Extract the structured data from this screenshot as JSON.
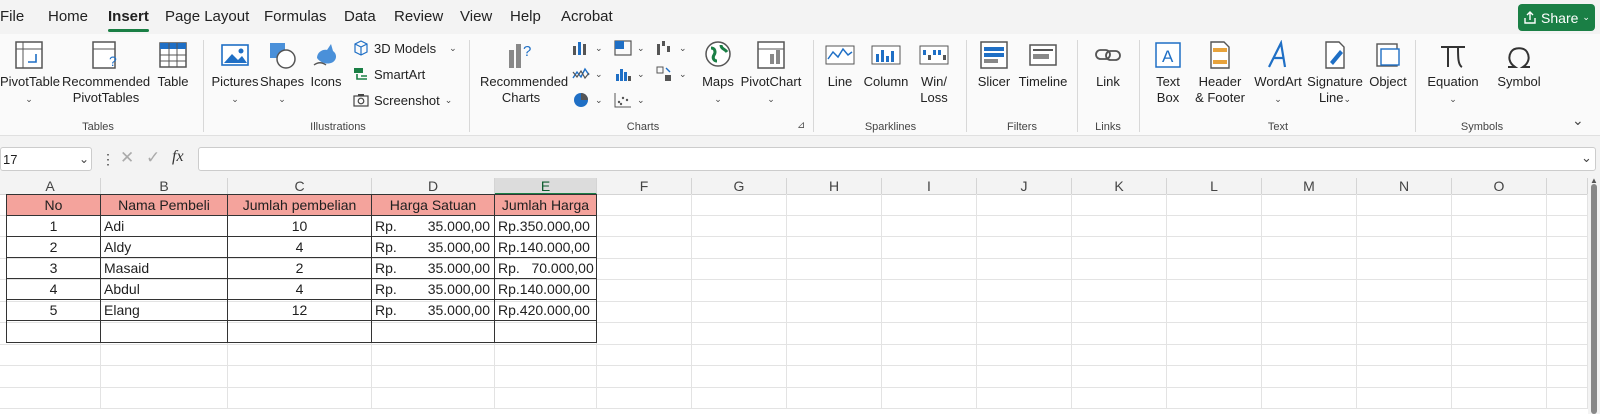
{
  "tabs": {
    "file": "File",
    "home": "Home",
    "insert": "Insert",
    "page_layout": "Page Layout",
    "formulas": "Formulas",
    "data": "Data",
    "review": "Review",
    "view": "View",
    "help": "Help",
    "acrobat": "Acrobat"
  },
  "share": {
    "label": "Share"
  },
  "ribbon": {
    "tables": {
      "pivottable": "PivotTable",
      "recommended_pivottables": [
        "Recommended",
        "PivotTables"
      ],
      "table": "Table",
      "group": "Tables"
    },
    "illustrations": {
      "pictures": "Pictures",
      "shapes": "Shapes",
      "icons": "Icons",
      "models_3d": "3D Models",
      "smartart": "SmartArt",
      "screenshot": "Screenshot",
      "group": "Illustrations"
    },
    "charts": {
      "recommended_charts": [
        "Recommended",
        "Charts"
      ],
      "maps": "Maps",
      "pivotchart": "PivotChart",
      "group": "Charts"
    },
    "sparklines": {
      "line": "Line",
      "column": "Column",
      "winloss": [
        "Win/",
        "Loss"
      ],
      "group": "Sparklines"
    },
    "filters": {
      "slicer": "Slicer",
      "timeline": "Timeline",
      "group": "Filters"
    },
    "links": {
      "link": "Link",
      "group": "Links"
    },
    "text": {
      "textbox": [
        "Text",
        "Box"
      ],
      "header_footer": [
        "Header",
        "& Footer"
      ],
      "wordart": "WordArt",
      "signature_line": [
        "Signature",
        "Line"
      ],
      "object": "Object",
      "group": "Text"
    },
    "symbols": {
      "equation": "Equation",
      "symbol": "Symbol",
      "group": "Symbols"
    }
  },
  "formula_bar": {
    "name_box": "17",
    "fx": "fx",
    "formula": ""
  },
  "columns": [
    "A",
    "B",
    "C",
    "D",
    "E",
    "F",
    "G",
    "H",
    "I",
    "J",
    "K",
    "L",
    "M",
    "N",
    "O"
  ],
  "table": {
    "headers": [
      "No",
      "Nama Pembeli",
      "Jumlah pembelian",
      "Harga Satuan",
      "Jumlah Harga"
    ],
    "rows": [
      {
        "no": "1",
        "nama": "Adi",
        "jumlah": "10",
        "rp": "Rp.",
        "harga": "35.000,00",
        "total": "Rp.350.000,00"
      },
      {
        "no": "2",
        "nama": "Aldy",
        "jumlah": "4",
        "rp": "Rp.",
        "harga": "35.000,00",
        "total": "Rp.140.000,00"
      },
      {
        "no": "3",
        "nama": "Masaid",
        "jumlah": "2",
        "rp": "Rp.",
        "harga": "35.000,00",
        "total": "Rp.   70.000,00"
      },
      {
        "no": "4",
        "nama": "Abdul",
        "jumlah": "4",
        "rp": "Rp.",
        "harga": "35.000,00",
        "total": "Rp.140.000,00"
      },
      {
        "no": "5",
        "nama": "Elang",
        "jumlah": "12",
        "rp": "Rp.",
        "harga": "35.000,00",
        "total": "Rp.420.000,00"
      }
    ]
  },
  "colors": {
    "accent": "#1a7f45",
    "header_fill": "#f4a39c"
  }
}
